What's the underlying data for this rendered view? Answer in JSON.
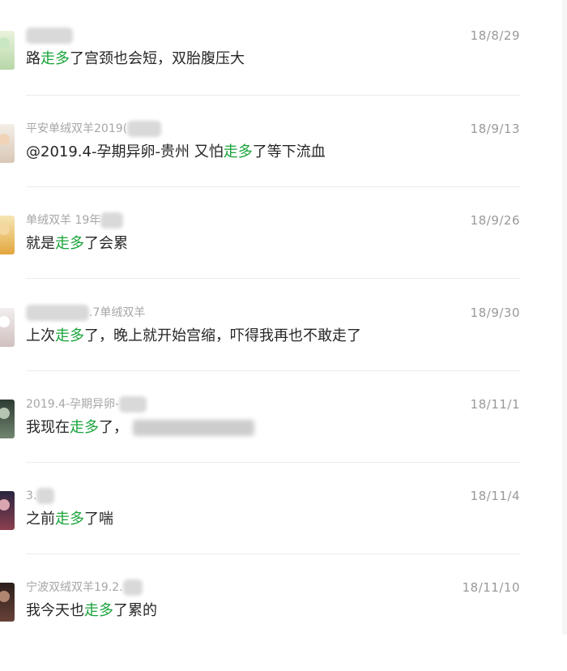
{
  "results": [
    {
      "name_visible": "",
      "date": "18/8/29",
      "message_before": "路",
      "keyword": "走多",
      "message_after": "了宫颈也会短，双胎腹压大"
    },
    {
      "name_visible": "平安单绒双羊2019(",
      "date": "18/9/13",
      "message_before": "@2019.4-孕期异卵-贵州 又怕",
      "keyword": "走多",
      "message_after": "了等下流血"
    },
    {
      "name_visible": "单绒双羊 19年",
      "date": "18/9/26",
      "message_before": "就是",
      "keyword": "走多",
      "message_after": "了会累"
    },
    {
      "name_visible": ".7单绒双羊",
      "date": "18/9/30",
      "message_before": "上次",
      "keyword": "走多",
      "message_after": "了，晚上就开始宫缩，吓得我再也不敢走了"
    },
    {
      "name_visible": "2019.4-孕期异卵-",
      "date": "18/11/1",
      "message_before": "我现在",
      "keyword": "走多",
      "message_after": "了，"
    },
    {
      "name_visible": "3.",
      "date": "18/11/4",
      "message_before": "之前",
      "keyword": "走多",
      "message_after": "了喘"
    },
    {
      "name_visible": "宁波双绒双羊19.2.",
      "date": "18/11/10",
      "message_before": "我今天也",
      "keyword": "走多",
      "message_after": "了累的"
    }
  ]
}
